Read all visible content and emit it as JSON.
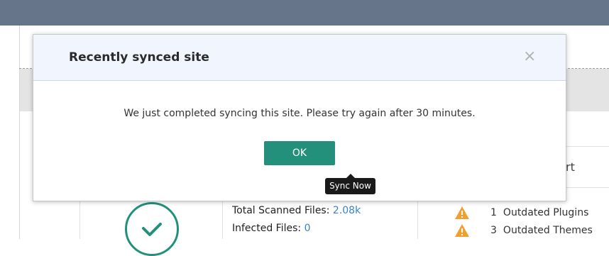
{
  "modal": {
    "title": "Recently synced site",
    "close_icon": "×",
    "message": "We just completed syncing this site. Please try again after 30 minutes.",
    "ok_label": "OK"
  },
  "tooltip": {
    "text": "Sync Now"
  },
  "background": {
    "right_partial_text": "rt",
    "scan": {
      "total_label": "Total Scanned Files:",
      "total_value": "2.08k",
      "infected_label": "Infected Files:",
      "infected_value": "0"
    },
    "updates": [
      {
        "count": "1",
        "label": "Outdated Plugins",
        "icon": "warning-icon"
      },
      {
        "count": "3",
        "label": "Outdated Themes",
        "icon": "warning-icon"
      }
    ]
  },
  "colors": {
    "topbar": "#66758a",
    "accent": "#23907c",
    "link": "#3a83c4",
    "warning": "#f0a030"
  }
}
